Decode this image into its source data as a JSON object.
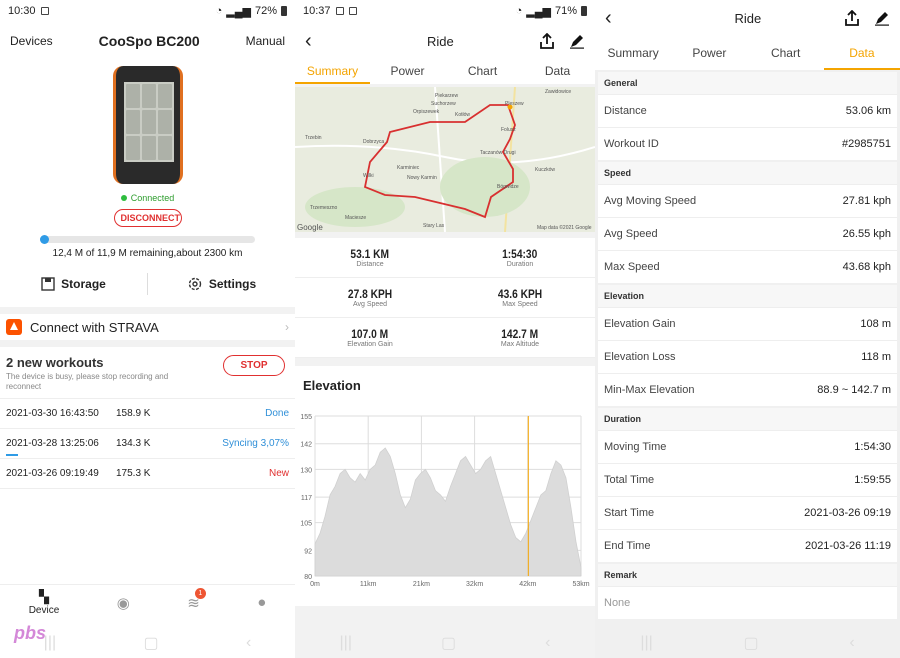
{
  "screen1": {
    "status": {
      "time": "10:30",
      "battery": "72%"
    },
    "header": {
      "left": "Devices",
      "title": "CooSpo BC200",
      "right": "Manual"
    },
    "connected": "Connected",
    "disconnect": "DISCONNECT",
    "storage": {
      "fraction": 0.04,
      "text": "12,4 M of 11,9 M remaining,about 2300 km"
    },
    "storage_label": "Storage",
    "settings_label": "Settings",
    "strava_label": "Connect with STRAVA",
    "workouts": {
      "title": "2 new workouts",
      "note": "The device is busy, please stop recording and reconnect",
      "stop": "STOP",
      "rows": [
        {
          "date": "2021-03-30 16:43:50",
          "size": "158.9 K",
          "status": "Done",
          "color": "#2f8fd8"
        },
        {
          "date": "2021-03-28 13:25:06",
          "size": "134.3 K",
          "status": "Syncing 3,07%",
          "color": "#2f8fd8"
        },
        {
          "date": "2021-03-26 09:19:49",
          "size": "175.3 K",
          "status": "New",
          "color": "#e03030"
        }
      ]
    },
    "tabbar": {
      "device": "Device",
      "badge": "1"
    },
    "watermark": "pbs"
  },
  "screen2": {
    "status": {
      "time": "10:37",
      "battery": "71%"
    },
    "header": {
      "title": "Ride"
    },
    "tabs": [
      "Summary",
      "Power",
      "Chart",
      "Data"
    ],
    "map_labels": [
      "Piekarzew",
      "Suchorzew",
      "Orpiszewek",
      "Kotłów",
      "Trzebin",
      "Dobrzyca",
      "Karminiec",
      "Nowy Karmin",
      "Wilki",
      "Trzemeszno",
      "Maciesze",
      "Zawidowice",
      "Pleszew",
      "Folusz",
      "Taczanów Drugi",
      "Kuczków",
      "Bógwidze",
      "Stary Las",
      "Google",
      "Map data ©2021 Google"
    ],
    "stats": [
      {
        "value": "53.1 KM",
        "label": "Distance"
      },
      {
        "value": "1:54:30",
        "label": "Duration"
      },
      {
        "value": "27.8 KPH",
        "label": "Avg Speed"
      },
      {
        "value": "43.6 KPH",
        "label": "Max Speed"
      },
      {
        "value": "107.0 M",
        "label": "Elevation Gain"
      },
      {
        "value": "142.7 M",
        "label": "Max Altitude"
      }
    ],
    "elevation_title": "Elevation"
  },
  "chart_data": {
    "type": "area",
    "title": "Elevation",
    "y_ticks": [
      80,
      92,
      105,
      117,
      130,
      142,
      155
    ],
    "x_ticks": [
      "0m",
      "11km",
      "21km",
      "32km",
      "42km",
      "53km"
    ],
    "ylim": [
      80,
      155
    ],
    "xlim": [
      0,
      53
    ],
    "marker_x": 42.5,
    "x": [
      0,
      1,
      2,
      3,
      4,
      5,
      6,
      7,
      8,
      9,
      10,
      11,
      12,
      13,
      14,
      15,
      16,
      17,
      18,
      19,
      20,
      21,
      22,
      23,
      24,
      25,
      26,
      27,
      28,
      29,
      30,
      31,
      32,
      33,
      34,
      35,
      36,
      37,
      38,
      39,
      40,
      41,
      42,
      43,
      44,
      45,
      46,
      47,
      48,
      49,
      50,
      51,
      52,
      53
    ],
    "values": [
      95,
      100,
      108,
      118,
      122,
      128,
      130,
      126,
      124,
      128,
      125,
      130,
      132,
      138,
      140,
      136,
      128,
      118,
      112,
      116,
      125,
      128,
      130,
      126,
      120,
      118,
      115,
      122,
      128,
      134,
      136,
      132,
      128,
      130,
      134,
      136,
      128,
      120,
      112,
      104,
      98,
      96,
      100,
      106,
      112,
      118,
      120,
      128,
      134,
      132,
      126,
      112,
      96,
      84
    ]
  },
  "screen3": {
    "header": {
      "title": "Ride"
    },
    "tabs": [
      "Summary",
      "Power",
      "Chart",
      "Data"
    ],
    "groups": [
      {
        "title": "General",
        "rows": [
          {
            "k": "Distance",
            "v": "53.06 km"
          },
          {
            "k": "Workout ID",
            "v": "#2985751"
          }
        ]
      },
      {
        "title": "Speed",
        "rows": [
          {
            "k": "Avg Moving Speed",
            "v": "27.81 kph"
          },
          {
            "k": "Avg Speed",
            "v": "26.55 kph"
          },
          {
            "k": "Max Speed",
            "v": "43.68 kph"
          }
        ]
      },
      {
        "title": "Elevation",
        "rows": [
          {
            "k": "Elevation Gain",
            "v": "108 m"
          },
          {
            "k": "Elevation Loss",
            "v": "118 m"
          },
          {
            "k": "Min-Max Elevation",
            "v": "88.9 ~ 142.7 m"
          }
        ]
      },
      {
        "title": "Duration",
        "rows": [
          {
            "k": "Moving Time",
            "v": "1:54:30"
          },
          {
            "k": "Total Time",
            "v": "1:59:55"
          },
          {
            "k": "Start Time",
            "v": "2021-03-26 09:19"
          },
          {
            "k": "End Time",
            "v": "2021-03-26 11:19"
          }
        ]
      },
      {
        "title": "Remark",
        "rows": [
          {
            "k": "None",
            "v": ""
          }
        ]
      }
    ]
  }
}
